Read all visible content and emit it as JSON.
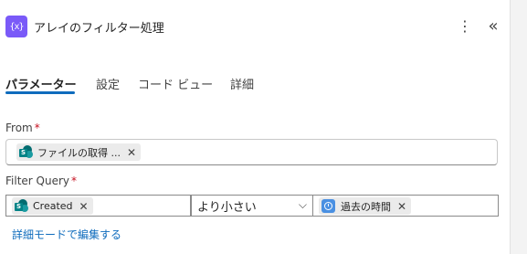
{
  "header": {
    "title": "アレイのフィルター処理",
    "icon": "filter-array-action-icon",
    "icon_glyph": "{x}",
    "more_glyph": "⋮",
    "collapse_glyph": "«",
    "accent": "#7a5af8"
  },
  "tabs": [
    {
      "label": "パラメーター",
      "active": true
    },
    {
      "label": "設定",
      "active": false
    },
    {
      "label": "コード ビュー",
      "active": false
    },
    {
      "label": "詳細",
      "active": false
    }
  ],
  "fields": {
    "from": {
      "label": "From",
      "required_mark": "*",
      "token": {
        "label": "ファイルの取得 ...",
        "icon": "sharepoint-icon",
        "remove_glyph": "✕"
      }
    },
    "filter_query": {
      "label": "Filter Query",
      "required_mark": "*",
      "left_token": {
        "label": "Created",
        "icon": "sharepoint-icon",
        "remove_glyph": "✕"
      },
      "operator": "より小さい",
      "operator_chevron": "⌵",
      "right_token": {
        "label": "過去の時間",
        "icon": "clock-icon",
        "remove_glyph": "✕"
      }
    }
  },
  "advanced_link": "詳細モードで編集する",
  "colors": {
    "link": "#0f6cbd",
    "tab_underline": "#0f6cbd",
    "required": "#c50f1f"
  }
}
